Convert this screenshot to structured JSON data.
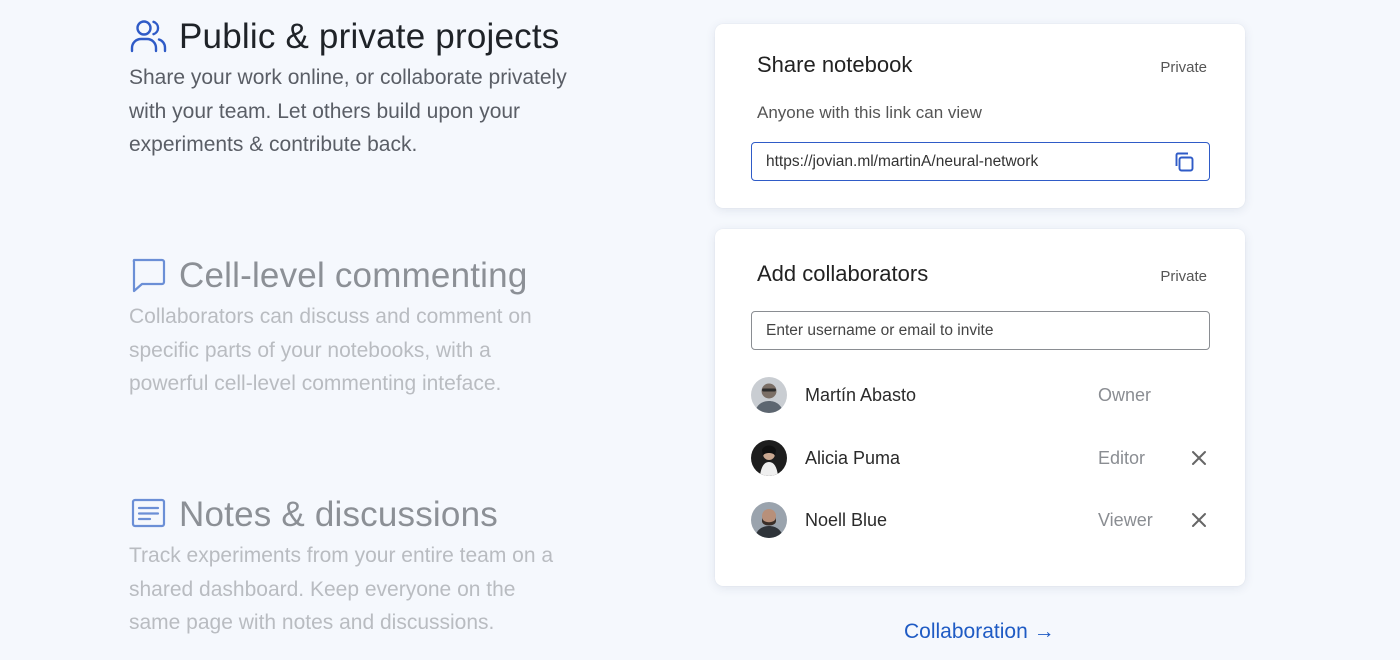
{
  "features": [
    {
      "icon": "users-icon",
      "title": "Public & private projects",
      "description": "Share your work online, or collaborate privately with your team. Let others build upon your experiments & contribute back."
    },
    {
      "icon": "comment-icon",
      "title": "Cell-level commenting",
      "description": "Collaborators can discuss and comment on specific parts of your notebooks, with a powerful cell-level commenting inteface."
    },
    {
      "icon": "notes-icon",
      "title": "Notes & discussions",
      "description": "Track experiments from your entire team on a shared dashboard. Keep everyone on the same page with notes and discussions."
    }
  ],
  "share_card": {
    "title": "Share notebook",
    "badge": "Private",
    "subtitle": "Anyone with this link can view",
    "link": "https://jovian.ml/martinA/neural-network",
    "copy_icon": "copy-icon"
  },
  "collab_card": {
    "title": "Add collaborators",
    "badge": "Private",
    "invite_placeholder": "Enter username or email to invite",
    "people": [
      {
        "name": "Martín Abasto",
        "role": "Owner"
      },
      {
        "name": "Alicia Puma",
        "role": "Editor"
      },
      {
        "name": "Noell Blue",
        "role": "Viewer"
      }
    ],
    "remove_icon": "close-icon"
  },
  "cta": {
    "label": "Collaboration →"
  },
  "colors": {
    "accent": "#2f5bc7",
    "link": "#1f5bc4",
    "background": "#f5f8fd"
  }
}
